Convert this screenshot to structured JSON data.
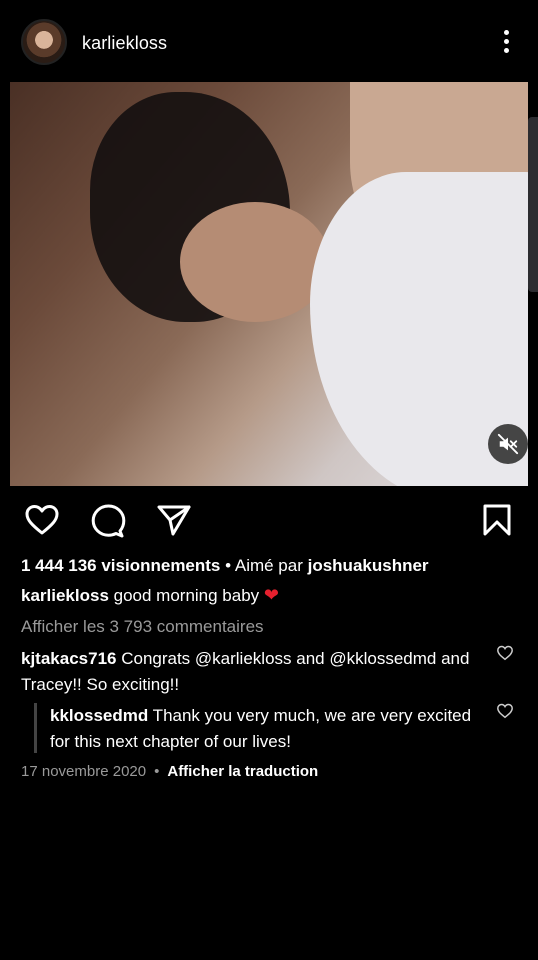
{
  "header": {
    "username": "karliekloss"
  },
  "post": {
    "views_count": "1 444 136 visionnements",
    "liked_by_prefix": " • Aimé par ",
    "liked_by_user": "joshuakushner",
    "caption_user": "karliekloss",
    "caption_text": " good morning baby ",
    "caption_emoji": "❤",
    "view_comments": "Afficher les 3 793 commentaires",
    "date": "17 novembre 2020",
    "date_separator": "•",
    "translate_label": "Afficher la traduction"
  },
  "comments": [
    {
      "user": "kjtakacs716",
      "text": " Congrats @karliekloss and @kklossedmd  and Tracey!! So exciting!!"
    },
    {
      "user": "kklossedmd",
      "text": " Thank you very much, we are very excited for this next chapter of our lives!"
    }
  ],
  "icons": {
    "more": "more-vertical-icon",
    "mute": "volume-muted-icon",
    "like": "heart-outline-icon",
    "comment": "comment-bubble-icon",
    "share": "paper-plane-icon",
    "save": "bookmark-icon"
  },
  "colors": {
    "background": "#000000",
    "text": "#ffffff",
    "muted_text": "#9a9a9a",
    "heart_emoji": "#e5202e"
  }
}
